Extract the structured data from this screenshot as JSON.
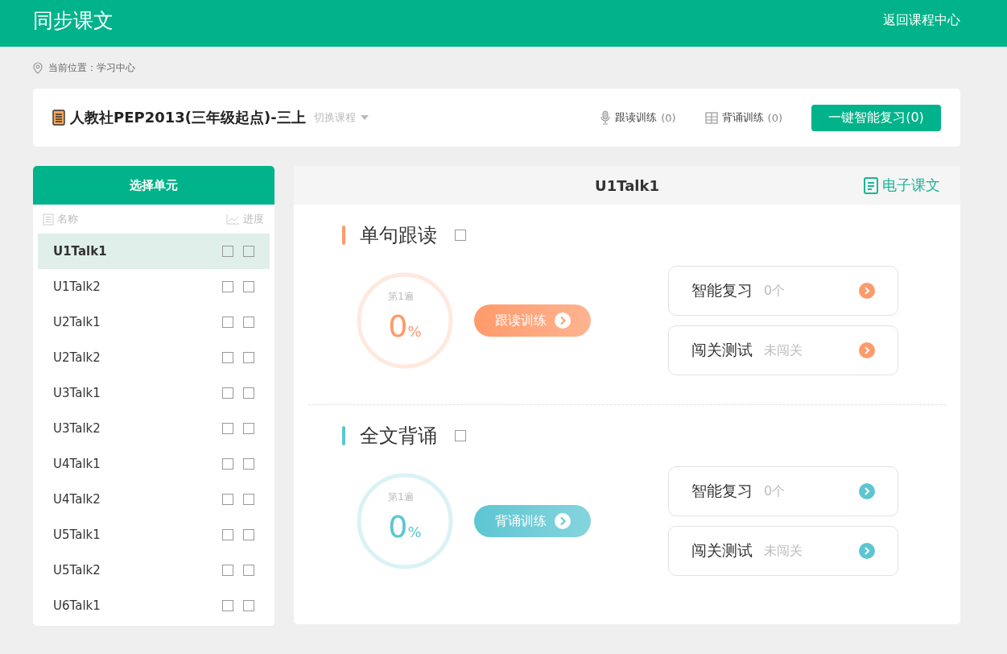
{
  "header": {
    "title": "同步课文",
    "back_link": "返回课程中心"
  },
  "breadcrumb": {
    "text": "当前位置：学习中心"
  },
  "course": {
    "title": "人教社PEP2013(三年级起点)-三上",
    "switch_label": "切换课程",
    "stats": [
      {
        "kind": "read",
        "label": "跟读训练",
        "count": "(0)"
      },
      {
        "kind": "recite",
        "label": "背诵训练",
        "count": "(0)"
      }
    ],
    "review_button": "一键智能复习(0)"
  },
  "units_panel": {
    "title": "选择单元",
    "columns": [
      {
        "kind": "name",
        "label": "名称"
      },
      {
        "kind": "progress",
        "label": "进度"
      }
    ],
    "units": [
      {
        "name": "U1Talk1",
        "selected": true,
        "read_done": false,
        "recite_done": false
      },
      {
        "name": "U1Talk2",
        "selected": false,
        "read_done": false,
        "recite_done": false
      },
      {
        "name": "U2Talk1",
        "selected": false,
        "read_done": false,
        "recite_done": false
      },
      {
        "name": "U2Talk2",
        "selected": false,
        "read_done": false,
        "recite_done": false
      },
      {
        "name": "U3Talk1",
        "selected": false,
        "read_done": false,
        "recite_done": false
      },
      {
        "name": "U3Talk2",
        "selected": false,
        "read_done": false,
        "recite_done": false
      },
      {
        "name": "U4Talk1",
        "selected": false,
        "read_done": false,
        "recite_done": false
      },
      {
        "name": "U4Talk2",
        "selected": false,
        "read_done": false,
        "recite_done": false
      },
      {
        "name": "U5Talk1",
        "selected": false,
        "read_done": false,
        "recite_done": false
      },
      {
        "name": "U5Talk2",
        "selected": false,
        "read_done": false,
        "recite_done": false
      },
      {
        "name": "U6Talk1",
        "selected": false,
        "read_done": false,
        "recite_done": false
      }
    ]
  },
  "lesson": {
    "title": "U1Talk1",
    "ebook_link": "电子课文",
    "sections": [
      {
        "title": "单句跟读",
        "color": "#ff9a6b",
        "done": false,
        "round": "第1遍",
        "percent": "0",
        "unit": "%",
        "button": "跟读训练",
        "items": [
          {
            "label": "智能复习",
            "value": "0个"
          },
          {
            "label": "闯关测试",
            "value": "未闯关"
          }
        ]
      },
      {
        "title": "全文背诵",
        "color": "#5cc6d2",
        "done": false,
        "round": "第1遍",
        "percent": "0",
        "unit": "%",
        "button": "背诵训练",
        "items": [
          {
            "label": "智能复习",
            "value": "0个"
          },
          {
            "label": "闯关测试",
            "value": "未闯关"
          }
        ]
      }
    ]
  }
}
